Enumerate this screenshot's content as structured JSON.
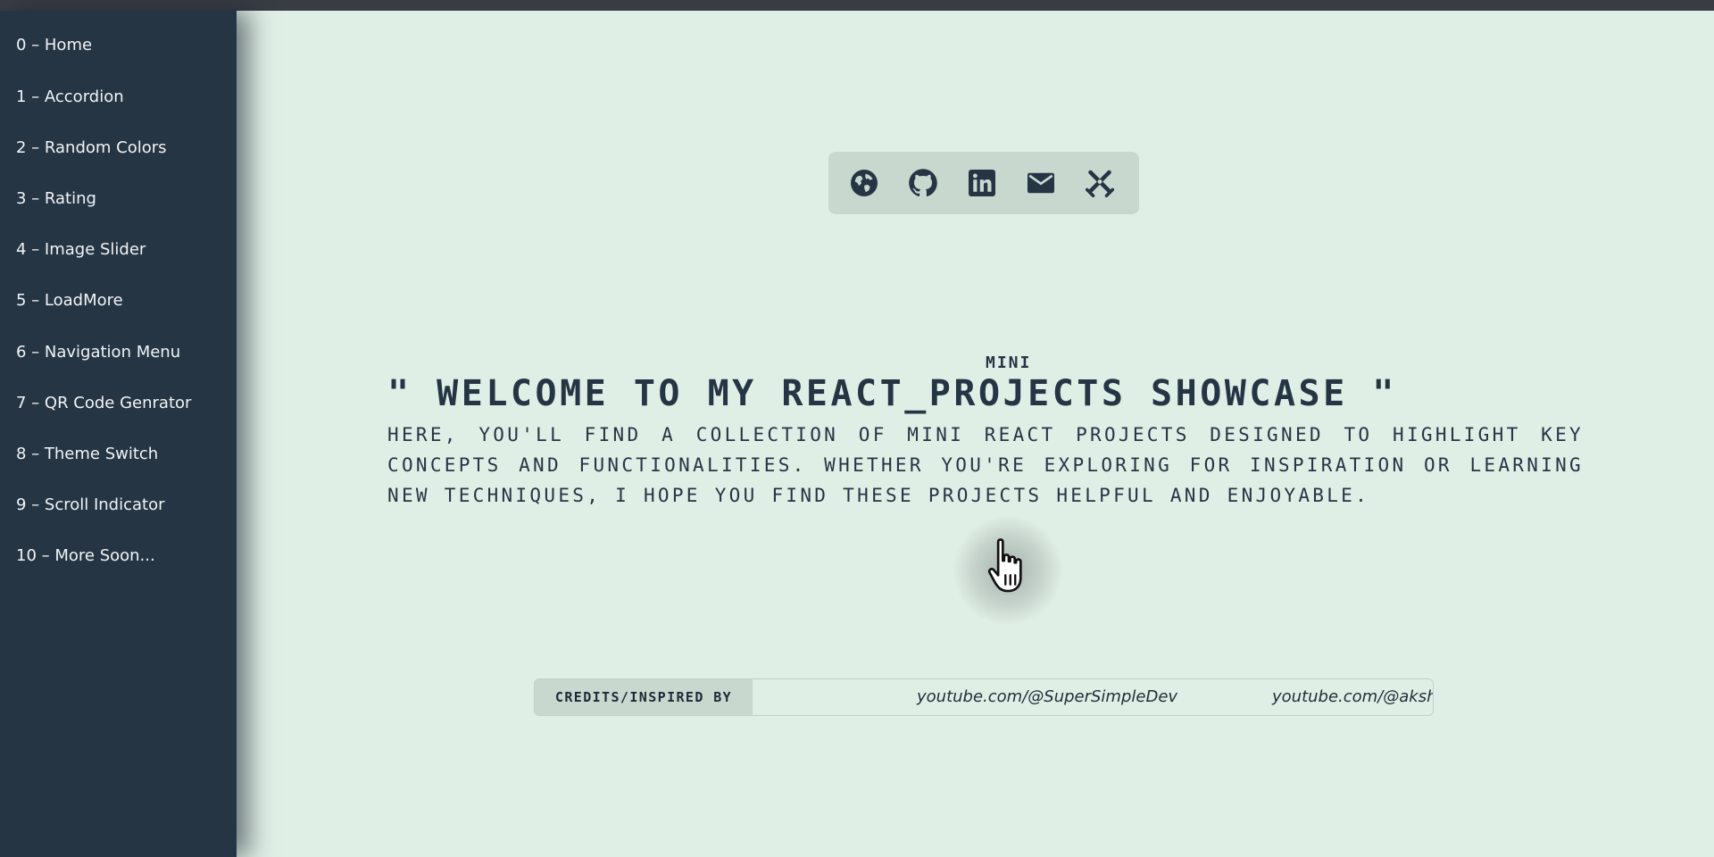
{
  "sidebar": {
    "items": [
      {
        "label": "0 – Home"
      },
      {
        "label": "1 – Accordion"
      },
      {
        "label": "2 – Random Colors"
      },
      {
        "label": "3 – Rating"
      },
      {
        "label": "4 – Image Slider"
      },
      {
        "label": "5 – LoadMore"
      },
      {
        "label": "6 – Navigation Menu"
      },
      {
        "label": "7 – QR Code Genrator"
      },
      {
        "label": "8 – Theme Switch"
      },
      {
        "label": "9 – Scroll Indicator"
      },
      {
        "label": "10 – More Soon..."
      }
    ]
  },
  "social": {
    "icons": [
      "globe-icon",
      "github-icon",
      "linkedin-icon",
      "mail-icon",
      "crossed-swords-icon"
    ]
  },
  "hero": {
    "mini": "MINI",
    "title": "\" WELCOME TO MY REACT_PROJECTS SHOWCASE \"",
    "intro": "HERE, YOU'LL FIND A COLLECTION OF MINI REACT PROJECTS DESIGNED TO HIGHLIGHT KEY CONCEPTS AND FUNCTIONALITIES. WHETHER YOU'RE EXPLORING FOR INSPIRATION OR LEARNING NEW TECHNIQUES, I HOPE YOU FIND THESE PROJECTS HELPFUL AND ENJOYABLE."
  },
  "credits": {
    "label": "CREDITS/INSPIRED BY",
    "links": [
      "youtube.com/@SuperSimpleDev",
      "youtube.com/@aksh"
    ]
  },
  "colors": {
    "sidebar_bg": "#253544",
    "page_bg": "#e0efe6",
    "panel_bg": "#c9d8cf",
    "text_dark": "#253544"
  }
}
